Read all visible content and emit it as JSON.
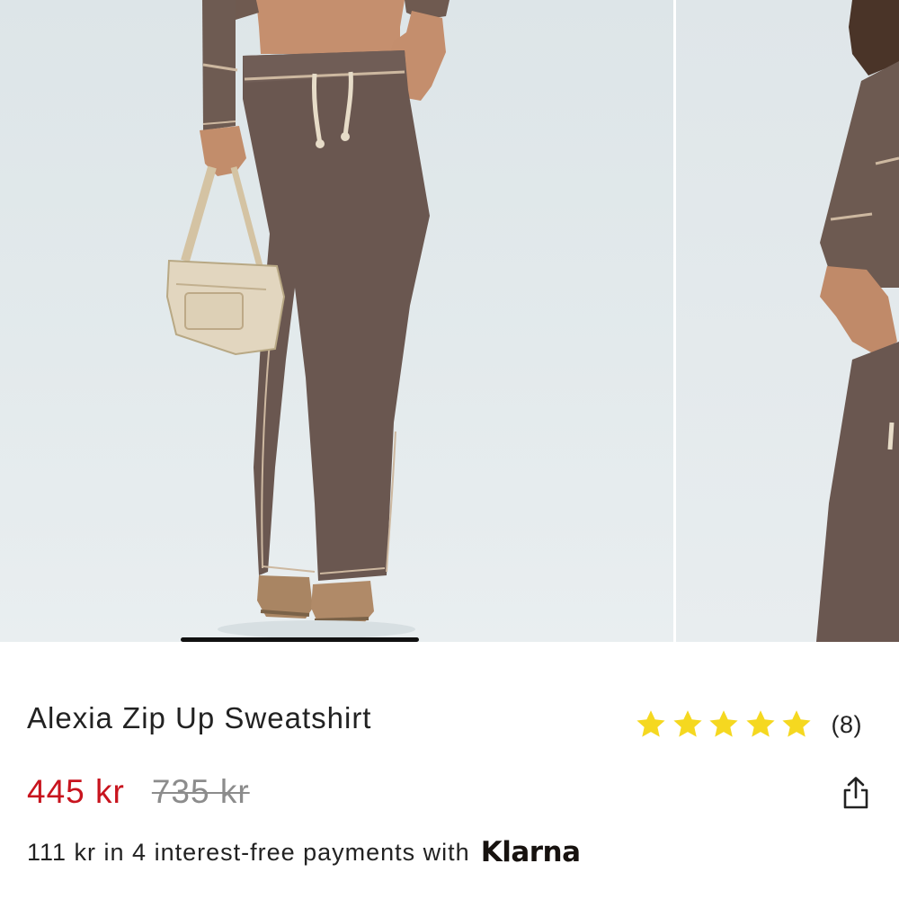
{
  "product": {
    "title": "Alexia Zip Up Sweatshirt",
    "rating": {
      "stars": 5,
      "count_label": "(8)",
      "star_color": "#f5d820"
    },
    "price": {
      "sale": "445 kr",
      "original": "735 kr",
      "sale_color": "#c8141e",
      "original_color": "#8c8c8c"
    },
    "installments": {
      "text": "111 kr in 4 interest-free payments with",
      "provider": "Klarna"
    }
  },
  "gallery": {
    "current_image": 1
  },
  "icons": {
    "share": "share-icon",
    "star": "star-icon"
  }
}
